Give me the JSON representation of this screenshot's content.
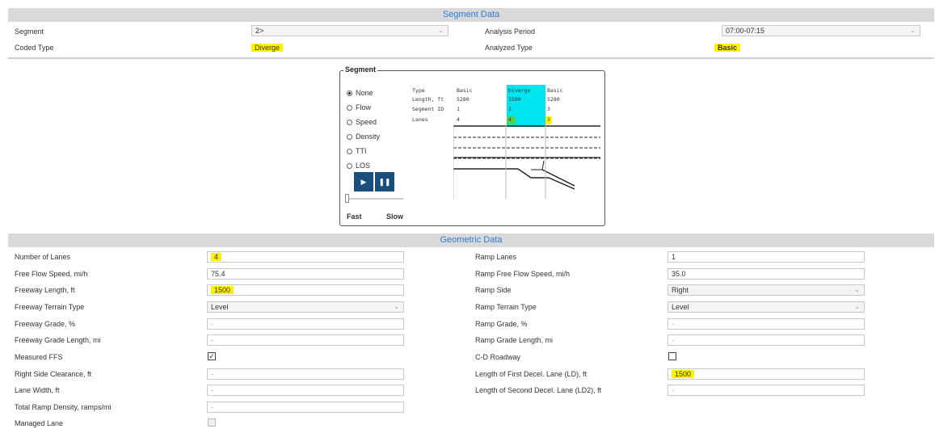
{
  "segment_data": {
    "title": "Segment Data",
    "segment_label": "Segment",
    "segment_value": "2>",
    "analysis_period_label": "Analysis Period",
    "analysis_period_value": "07:00-07:15",
    "coded_type_label": "Coded Type",
    "coded_type_value": "Diverge",
    "analyzed_type_label": "Analyzed Type",
    "analyzed_type_value": "Basic"
  },
  "segment_panel": {
    "title": "Segment",
    "options": [
      "None",
      "Flow",
      "Speed",
      "Density",
      "TTI",
      "LOS"
    ],
    "selected": "None",
    "speed_fast": "Fast",
    "speed_slow": "Slow",
    "table": {
      "row_labels": [
        "Type",
        "Length, ft",
        "Segment ID",
        "Lanes"
      ],
      "columns": [
        {
          "type": "Basic",
          "length": "5280",
          "id": "1",
          "lanes": "4"
        },
        {
          "type": "Diverge",
          "length": "1500",
          "id": "2",
          "lanes": "4"
        },
        {
          "type": "Basic",
          "length": "5280",
          "id": "3",
          "lanes": "3"
        }
      ]
    },
    "colors": {
      "selected_column": "#00e5f0",
      "lanes_green": "#4cd44c",
      "lanes_yellow": "#fff200"
    }
  },
  "geometric_data": {
    "title": "Geometric Data",
    "left": [
      {
        "label": "Number of Lanes",
        "value": "4"
      },
      {
        "label": "Free Flow Speed, mi/h",
        "value": "75.4"
      },
      {
        "label": "Freeway Length, ft",
        "value": "1500"
      },
      {
        "label": "Freeway Terrain Type",
        "value": "Level"
      },
      {
        "label": "Freeway Grade, %",
        "value": "-"
      },
      {
        "label": "Freeway Grade Length, mi",
        "value": "-"
      },
      {
        "label": "Measured FFS",
        "value": "✓"
      },
      {
        "label": "Right Side Clearance, ft",
        "value": "-"
      },
      {
        "label": "Lane Width, ft",
        "value": "-"
      },
      {
        "label": "Total Ramp Density, ramps/mi",
        "value": "-"
      },
      {
        "label": "Managed Lane",
        "value": ""
      }
    ],
    "right": [
      {
        "label": "Ramp Lanes",
        "value": "1"
      },
      {
        "label": "Ramp Free Flow Speed, mi/h",
        "value": "35.0"
      },
      {
        "label": "Ramp Side",
        "value": "Right"
      },
      {
        "label": "Ramp Terrain Type",
        "value": "Level"
      },
      {
        "label": "Ramp Grade, %",
        "value": "-"
      },
      {
        "label": "Ramp Grade Length, mi",
        "value": "-"
      },
      {
        "label": "C-D Roadway",
        "value": ""
      },
      {
        "label": "Length of First Decel. Lane (LD), ft",
        "value": "1500"
      },
      {
        "label": "Length of Second Decel. Lane (LD2), ft",
        "value": "-"
      }
    ]
  },
  "colors": {
    "header_bg": "#d9d9d9",
    "header_text": "#2e7bd6",
    "highlight": "#fff200",
    "button": "#1a4e7c"
  }
}
